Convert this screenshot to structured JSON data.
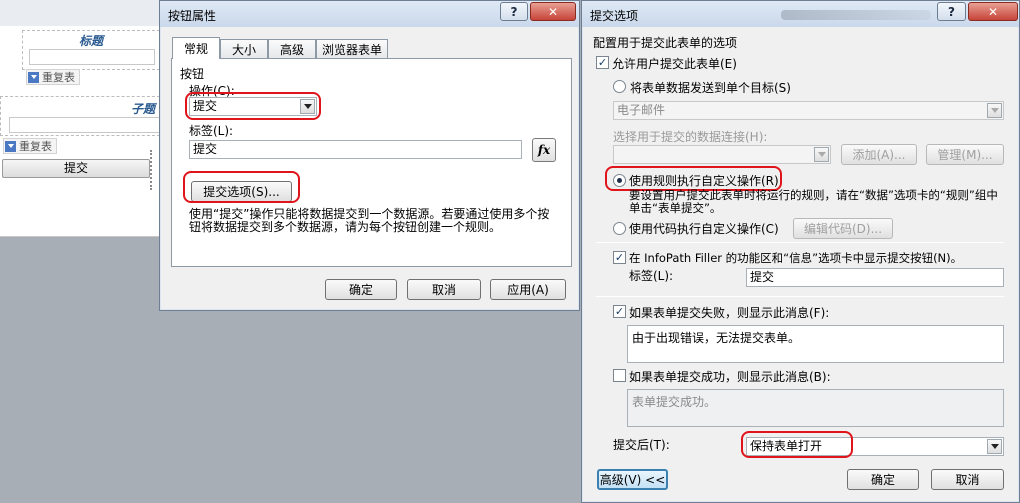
{
  "background": {
    "title_label": "标题",
    "section_label": "子题",
    "repeat_label_1": "重复表",
    "repeat_label_2": "重复表",
    "submit_button": "提交"
  },
  "button_properties": {
    "window_title": "按钮属性",
    "help_glyph": "?",
    "close_glyph": "✕",
    "tabs": [
      {
        "label": "常规",
        "active": true
      },
      {
        "label": "大小",
        "active": false
      },
      {
        "label": "高级",
        "active": false
      },
      {
        "label": "浏览器表单",
        "active": false
      }
    ],
    "group_label": "按钮",
    "action_label": "操作(C):",
    "action_value": "提交",
    "caption_label": "标签(L):",
    "caption_value": "提交",
    "fx_label": "fx",
    "submit_options_button": "提交选项(S)...",
    "description": "使用“提交”操作只能将数据提交到一个数据源。若要通过使用多个按钮将数据提交到多个数据源，请为每个按钮创建一个规则。",
    "ok": "确定",
    "cancel": "取消",
    "apply": "应用(A)"
  },
  "submit_options": {
    "window_title": "提交选项",
    "help_glyph": "?",
    "close_glyph": "✕",
    "heading": "配置用于提交此表单的选项",
    "allow_submit_label": "允许用户提交此表单(E)",
    "allow_submit_checked": true,
    "single_target_label": "将表单数据发送到单个目标(S)",
    "destination_value": "电子邮件",
    "data_connection_label": "选择用于提交的数据连接(H):",
    "add_button": "添加(A)...",
    "manage_button": "管理(M)...",
    "rules_label": "使用规则执行自定义操作(R)",
    "rules_selected": true,
    "rules_hint": "要设置用户提交此表单时将运行的规则，请在“数据”选项卡的“规则”组中单击“表单提交”。",
    "code_label": "使用代码执行自定义操作(C)",
    "edit_code_button": "编辑代码(D)...",
    "show_button_label": "在 InfoPath Filler 的功能区和“信息”选项卡中显示提交按钮(N)。",
    "show_button_checked": true,
    "caption_label": "标签(L):",
    "caption_value": "提交",
    "fail_label": "如果表单提交失败，则显示此消息(F):",
    "fail_checked": true,
    "fail_message": "由于出现错误，无法提交表单。",
    "success_label": "如果表单提交成功，则显示此消息(B):",
    "success_checked": false,
    "success_message": "表单提交成功。",
    "after_submit_label": "提交后(T):",
    "after_submit_value": "保持表单打开",
    "advanced_button": "高级(V) <<",
    "ok": "确定",
    "cancel": "取消"
  },
  "colors": {
    "highlight": "#e0141b",
    "dialog_bg": "#f0f0f0",
    "titlebar": "#c9d8eb"
  }
}
